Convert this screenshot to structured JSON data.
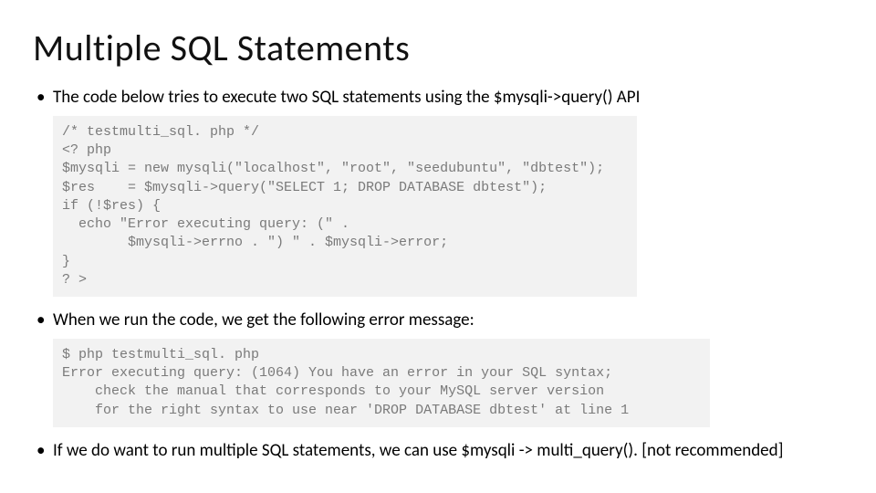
{
  "title": "Multiple SQL Statements",
  "bullet1": "The code below tries to execute two SQL statements using the $mysqli->query() API",
  "code1": "/* testmulti_sql. php */\n<? php\n$mysqli = new mysqli(\"localhost\", \"root\", \"seedubuntu\", \"dbtest\");\n$res    = $mysqli->query(\"SELECT 1; DROP DATABASE dbtest\");\nif (!$res) {\n  echo \"Error executing query: (\" .\n        $mysqli->errno . \") \" . $mysqli->error;\n}\n? >",
  "bullet2": "When we run the code, we get the following error message:",
  "code2": "$ php testmulti_sql. php\nError executing query: (1064) You have an error in your SQL syntax;\n    check the manual that corresponds to your MySQL server version\n    for the right syntax to use near 'DROP DATABASE dbtest' at line 1",
  "bullet3": "If we do want to run multiple SQL statements, we can use $mysqli -> multi_query(). [not recommended]"
}
